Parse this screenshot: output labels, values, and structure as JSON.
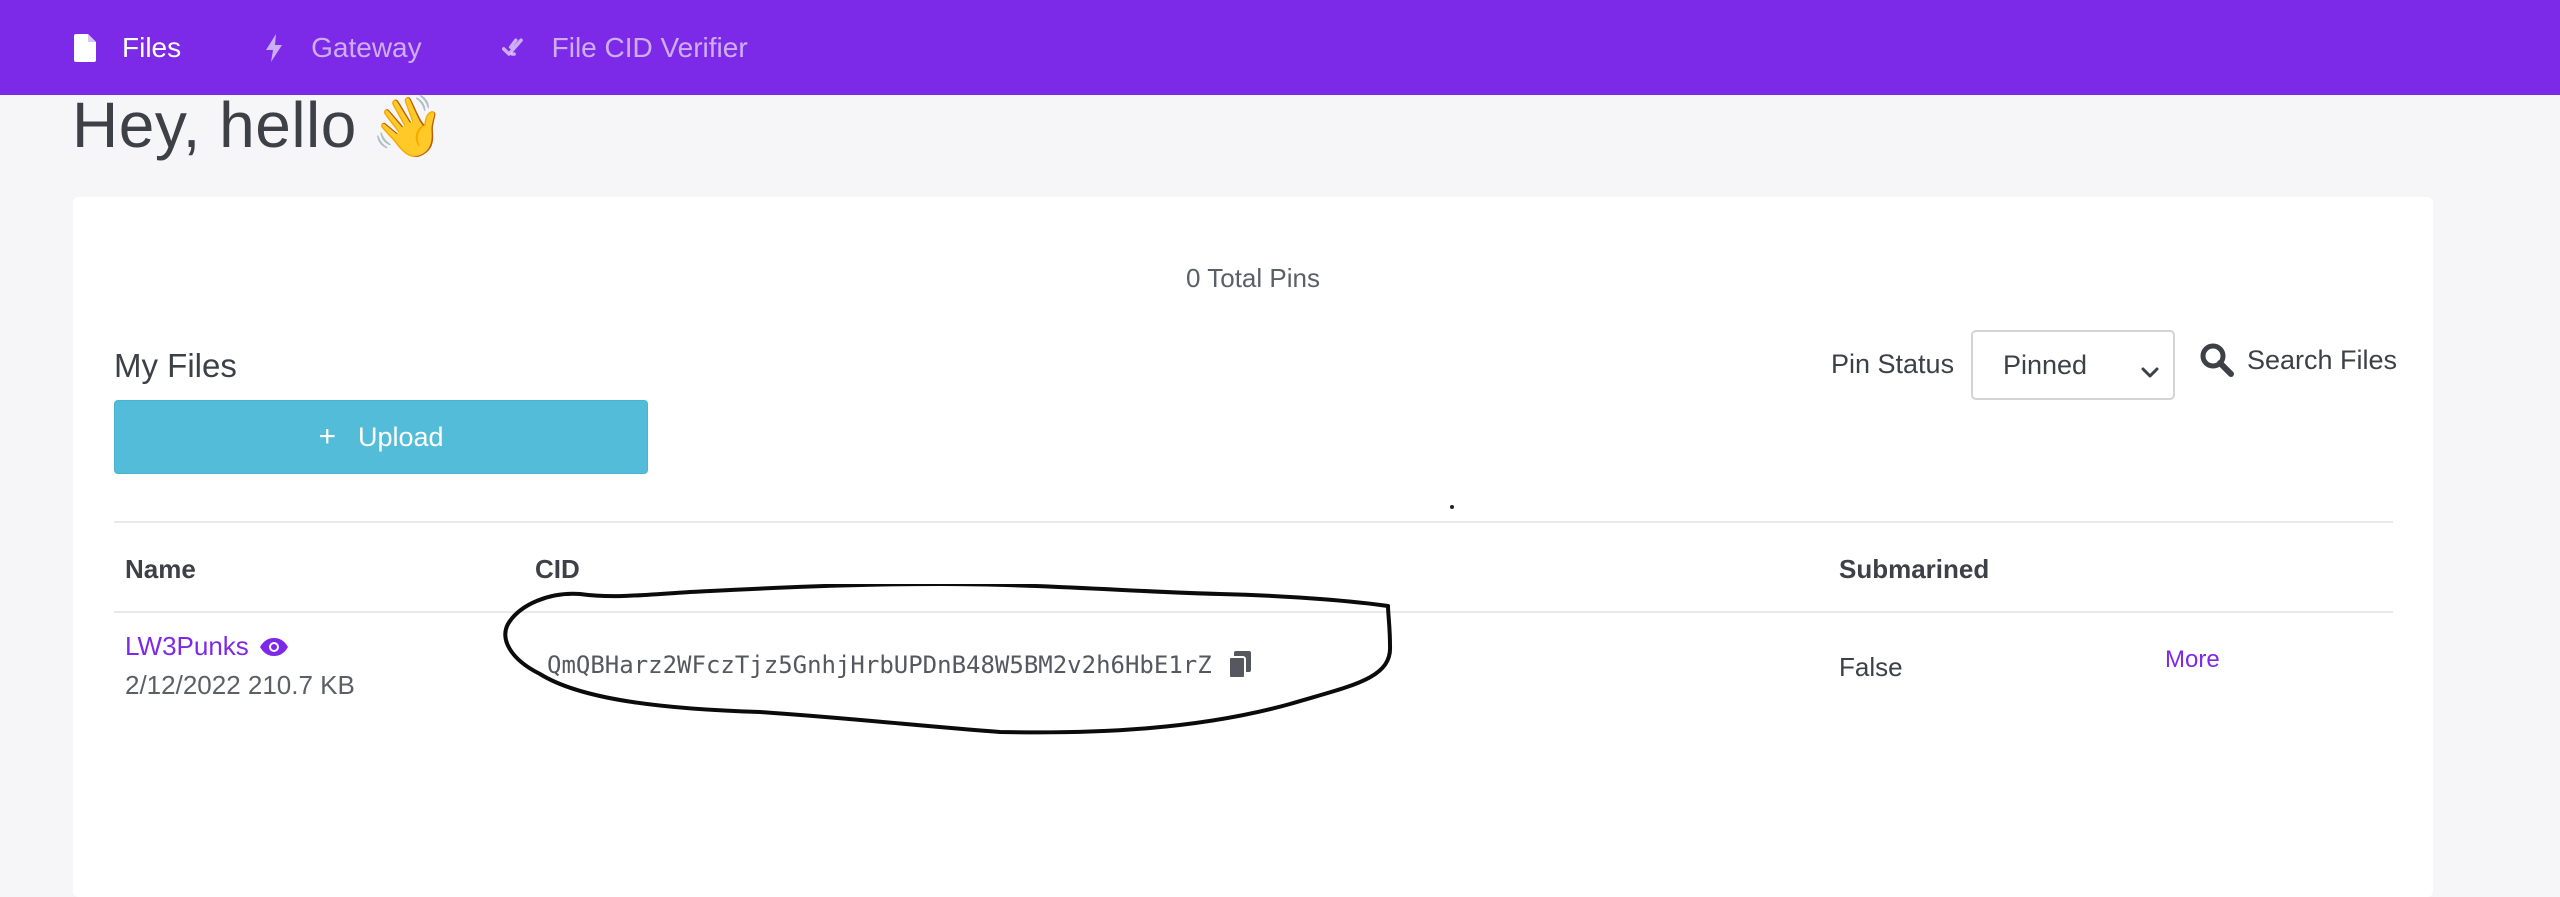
{
  "nav": {
    "files": "Files",
    "gateway": "Gateway",
    "verifier": "File CID Verifier"
  },
  "greeting": {
    "text": "Hey, hello",
    "emoji": "👋"
  },
  "stats": {
    "total_pins": "0 Total Pins"
  },
  "my_files": {
    "title": "My Files",
    "upload_icon": "+",
    "upload_label": "Upload"
  },
  "filters": {
    "pin_status_label": "Pin Status",
    "pin_status_value": "Pinned",
    "search_label": "Search Files"
  },
  "table": {
    "headers": {
      "name": "Name",
      "cid": "CID",
      "submarined": "Submarined"
    },
    "rows": [
      {
        "name": "LW3Punks",
        "date": "2/12/2022",
        "size": "210.7 KB",
        "meta": "2/12/2022 210.7 KB",
        "cid": "QmQBHarz2WFczTjz5GnhjHrbUPDnB48W5BM2v2h6HbE1rZ",
        "submarined": "False",
        "more": "More"
      }
    ]
  },
  "colors": {
    "brand_purple": "#7d29e8",
    "upload_blue": "#52bcd9",
    "page_bg": "#f6f6f8"
  },
  "icons": {
    "files": "file-icon",
    "gateway": "bolt-icon",
    "verifier": "double-check-icon",
    "search": "search-icon",
    "eye": "eye-icon",
    "copy": "copy-icon",
    "select": "chevron-down-icon"
  }
}
